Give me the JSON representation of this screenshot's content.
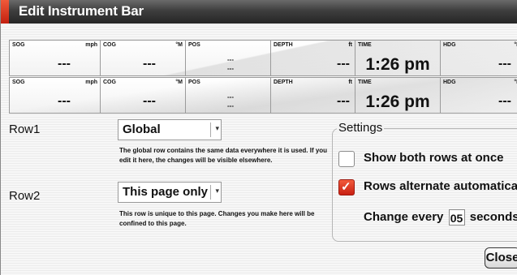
{
  "dialog": {
    "title": "Edit Instrument Bar"
  },
  "bars": [
    {
      "cells": [
        {
          "label": "SOG",
          "unit": "mph",
          "value": "---"
        },
        {
          "label": "COG",
          "unit": "°M",
          "value": "---"
        },
        {
          "label": "POS",
          "unit": "",
          "line1": "---",
          "line2": "---"
        },
        {
          "label": "DEPTH",
          "unit": "ft",
          "value": "---"
        },
        {
          "label": "TIME",
          "unit": "",
          "value": "1:26 pm"
        },
        {
          "label": "HDG",
          "unit": "°M",
          "value": "---"
        }
      ]
    },
    {
      "cells": [
        {
          "label": "SOG",
          "unit": "mph",
          "value": "---"
        },
        {
          "label": "COG",
          "unit": "°M",
          "value": "---"
        },
        {
          "label": "POS",
          "unit": "",
          "line1": "---",
          "line2": "---"
        },
        {
          "label": "DEPTH",
          "unit": "ft",
          "value": "---"
        },
        {
          "label": "TIME",
          "unit": "",
          "value": "1:26 pm"
        },
        {
          "label": "HDG",
          "unit": "°M",
          "value": "---"
        }
      ]
    }
  ],
  "row1": {
    "label": "Row1",
    "selected": "Global",
    "description": "The global row contains the same data everywhere it is used. If you edit it here, the changes will be visible elsewhere."
  },
  "row2": {
    "label": "Row2",
    "selected": "This page only",
    "description": "This row is unique to this page. Changes you make here will be confined to this page."
  },
  "settings": {
    "title": "Settings",
    "show_both": {
      "label": "Show both rows at once",
      "checked": false
    },
    "alternate": {
      "label": "Rows alternate automatically",
      "checked": true
    },
    "change_every_prefix": "Change every",
    "change_every_value": "05",
    "change_every_suffix": "seconds"
  },
  "buttons": {
    "close": "Close"
  },
  "colors": {
    "accent": "#d9301c",
    "titlebar": "#2e2e2e"
  },
  "icons": {
    "dropdown": "chevron-down-icon",
    "check": "checkmark-icon"
  }
}
